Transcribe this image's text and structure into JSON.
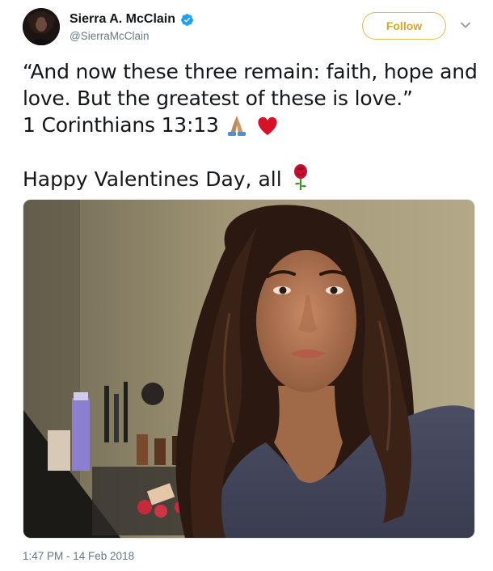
{
  "user": {
    "display_name": "Sierra A. McClain",
    "handle": "@SierraMcClain",
    "verified": true
  },
  "actions": {
    "follow_label": "Follow"
  },
  "tweet": {
    "line1": "“And now these three remain: faith, hope and",
    "line2": "love. But the greatest of these is love.”",
    "line3": "1 Corinthians 13:13",
    "line4": "Happy Valentines Day, all",
    "emojis": [
      "folded-hands-icon",
      "red-heart-icon",
      "rose-icon"
    ]
  },
  "media": {
    "alt": "selfie photo"
  },
  "timestamp": "1:47 PM - 14 Feb 2018",
  "colors": {
    "follow_accent": "#d9a42b",
    "verified_blue": "#1da1f2",
    "secondary_text": "#657786"
  }
}
